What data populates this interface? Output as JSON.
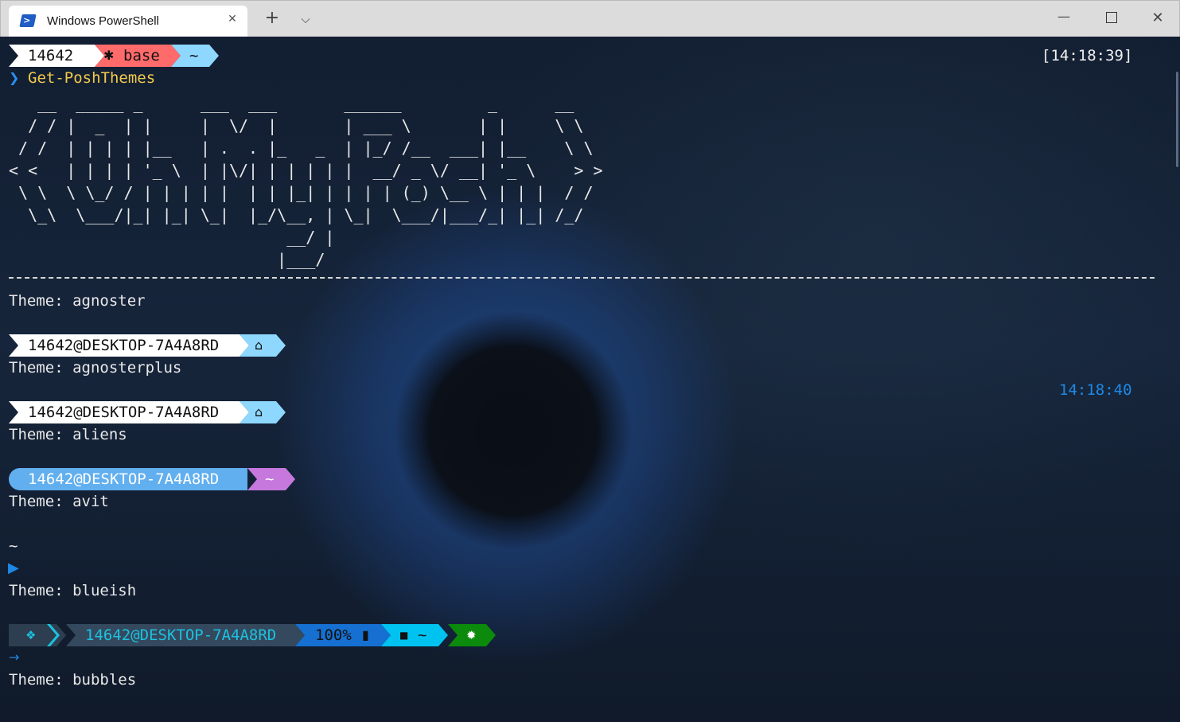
{
  "window": {
    "tab_title": "Windows PowerShell",
    "tab_icon": "powershell-icon",
    "tab_icon_glyph": ">",
    "close_tab_glyph": "✕",
    "new_tab_glyph": "+",
    "dropdown_glyph": "⌵",
    "minimize_glyph": "—",
    "close_glyph": "✕"
  },
  "prompt": {
    "user": "14642",
    "env_icon": "✱",
    "env": "base",
    "path": "~",
    "time": "[14:18:39]",
    "chevron": "❯",
    "command": "Get-PoshThemes"
  },
  "ascii_art": "   __  _____ _      ___  ___       ______         _      __   \n  / / |  _  | |     |  \\/  |       | ___ \\       | |     \\ \\  \n / /  | | | | |__   | .  . |_   _  | |_/ /__  ___| |__    \\ \\ \n< <   | | | | '_ \\  | |\\/| | | | | |  __/ _ \\/ __| '_ \\    > >\n \\ \\  \\ \\_/ / | | | | |  | | |_| | | | | (_) \\__ \\ | | |  / / \n  \\_\\  \\___/|_| |_| \\_|  |_/\\__, | \\_|  \\___/|___/_| |_| /_/  \n                             __/ |                           \n                            |___/                            ",
  "colors": {
    "agnoster_user_bg": "#ffffff",
    "agnoster_env_bg": "#ff6b6b",
    "agnoster_path_bg": "#8ed8ff",
    "avit_user_bg": "#61afef",
    "avit_path_bg": "#c678dd",
    "blueish_accent": "#1e88e5",
    "bubbles_bg1": "#2c3e50",
    "bubbles_user_bg": "#34495e",
    "bubbles_user_fg": "#1cc1df",
    "bubbles_battery_bg": "#1570d1",
    "bubbles_path_bg": "#00c2f0",
    "bubbles_git_bg": "#0b8a0b"
  },
  "themes": [
    {
      "name": "Theme: agnoster"
    },
    {
      "name": "Theme: agnosterplus",
      "user": "14642@DESKTOP-7A4A8RD",
      "home_icon": "⌂"
    },
    {
      "name": "Theme: aliens",
      "user": "14642@DESKTOP-7A4A8RD",
      "home_icon": "⌂",
      "time": "14:18:40"
    },
    {
      "name": "Theme: avit",
      "user": "14642@DESKTOP-7A4A8RD",
      "path": "~"
    },
    {
      "name": "Theme: blueish",
      "path": "~",
      "arrow": "▶"
    },
    {
      "name": "Theme: bubbles",
      "windows_icon": "❖",
      "user": "14642@DESKTOP-7A4A8RD",
      "battery": "100%",
      "battery_icon": "▮",
      "folder_icon": "■",
      "path": "~",
      "git_icon": "✹",
      "arrow": "→"
    }
  ]
}
